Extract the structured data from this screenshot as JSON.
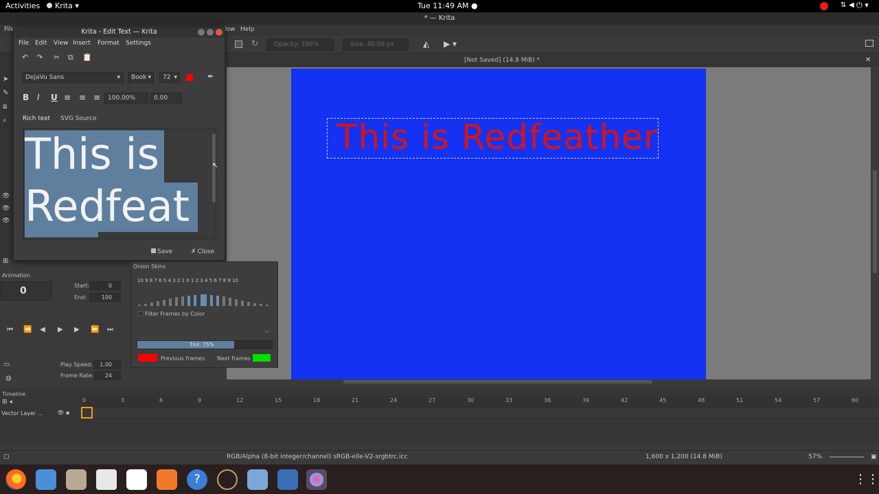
{
  "topbar": {
    "activities": "Activities",
    "app": "Krita ▾",
    "clock": "Tue 11:49 AM ●"
  },
  "window": {
    "title": "* — Krita"
  },
  "menubar": {
    "file": "File",
    "window_partial": "low",
    "help": "Help"
  },
  "toolbar": {
    "opacity": "Opacity: 100%",
    "size": "Size: 40.00 px"
  },
  "document": {
    "tab": "[Not Saved]  (14.8 MiB) *",
    "canvas_text": "This is Redfeather"
  },
  "dialog": {
    "title": "Krita - Edit Text — Krita",
    "menu": [
      "File",
      "Edit",
      "View",
      "Insert",
      "Format",
      "Settings"
    ],
    "font": "DejaVu Sans",
    "style": "Book",
    "size": "72",
    "line_height": "100.00%",
    "spacing": "0.00",
    "tabs": {
      "rich": "Rich text",
      "svg": "SVG Source"
    },
    "text_lines": [
      "This is",
      "Redfeat"
    ],
    "save": "Save",
    "close": "Close"
  },
  "animation": {
    "title": "Animation",
    "current_frame": "0",
    "start_label": "Start:",
    "start": "0",
    "end_label": "End:",
    "end": "100",
    "play_speed_label": "Play Speed:",
    "play_speed": "1.00",
    "frame_rate_label": "Frame Rate:",
    "frame_rate": "24"
  },
  "onion": {
    "title": "Onion Skins",
    "frames": "10 9 8 7 6 5 4 3 2 1  0  1 2 3 4 5 6 7 8 9 10",
    "filter": "Filter Frames by Color",
    "tint": "Tint: 75%",
    "tint_value": 0.75,
    "previous": "Previous frames",
    "next": "Next frames",
    "prev_color": "#ff0000",
    "next_color": "#00e000"
  },
  "timeline": {
    "title": "Timeline",
    "layer": "Vector Layer ...",
    "ticks": [
      "0",
      "3",
      "6",
      "9",
      "12",
      "15",
      "18",
      "21",
      "24",
      "27",
      "30",
      "33",
      "36",
      "39",
      "42",
      "45",
      "48",
      "51",
      "54",
      "57",
      "60"
    ]
  },
  "status": {
    "color": "RGB/Alpha (8-bit integer/channel)  sRGB-elle-V2-srgbtrc.icc",
    "dims": "1,600 x 1,200 (14.8 MiB)",
    "zoom": "57%"
  },
  "colors": {
    "canvas": "#1432f4",
    "text": "#d61414",
    "selection": "#5f7f9f"
  }
}
